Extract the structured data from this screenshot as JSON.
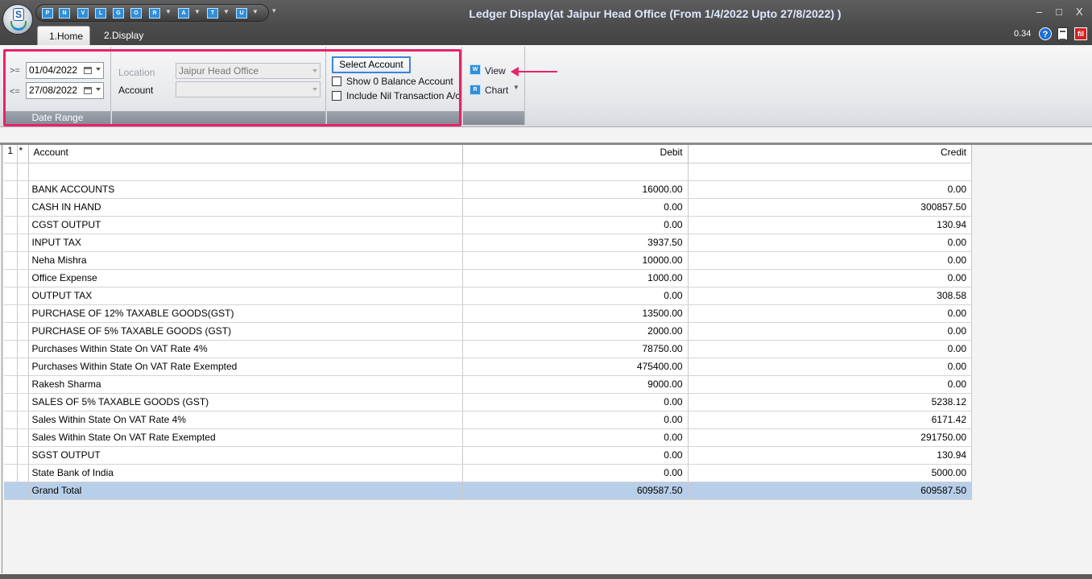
{
  "window": {
    "title": "Ledger Display(at Jaipur Head Office  (From 1/4/2022 Upto 27/8/2022) )",
    "controls": [
      "–",
      "□",
      "X"
    ]
  },
  "quick_access": [
    "P",
    "N",
    "V",
    "L",
    "G",
    "O",
    "R",
    "A",
    "T",
    "U"
  ],
  "tabs": [
    {
      "label": "1.Home",
      "active": true
    },
    {
      "label": "2.Display",
      "active": false
    }
  ],
  "status_right": {
    "value": "0.34"
  },
  "ribbon": {
    "date_range": {
      "from_op": ">=",
      "from_value": "01/04/2022",
      "to_op": "<=",
      "to_value": "27/08/2022",
      "group_label": "Date Range"
    },
    "location_label": "Location",
    "location_value": "Jaipur Head Office",
    "account_label": "Account",
    "account_value": "",
    "select_account_label": "Select Account",
    "show_zero_balance_label": "Show 0 Balance Account",
    "include_nil_label": "Include Nil Transaction A/c",
    "view_label": "View",
    "chart_label": "Chart"
  },
  "grid": {
    "header": {
      "rownum": "1",
      "star": "*",
      "account": "Account",
      "debit": "Debit",
      "credit": "Credit"
    },
    "rows": [
      {
        "account": "BANK ACCOUNTS",
        "debit": "16000.00",
        "credit": "0.00"
      },
      {
        "account": "CASH IN HAND",
        "debit": "0.00",
        "credit": "300857.50"
      },
      {
        "account": "CGST OUTPUT",
        "debit": "0.00",
        "credit": "130.94"
      },
      {
        "account": "INPUT TAX",
        "debit": "3937.50",
        "credit": "0.00"
      },
      {
        "account": "Neha Mishra",
        "debit": "10000.00",
        "credit": "0.00"
      },
      {
        "account": "Office Expense",
        "debit": "1000.00",
        "credit": "0.00"
      },
      {
        "account": "OUTPUT TAX",
        "debit": "0.00",
        "credit": "308.58"
      },
      {
        "account": "PURCHASE OF 12% TAXABLE GOODS(GST)",
        "debit": "13500.00",
        "credit": "0.00"
      },
      {
        "account": "PURCHASE OF 5% TAXABLE GOODS (GST)",
        "debit": "2000.00",
        "credit": "0.00"
      },
      {
        "account": "Purchases Within State On VAT Rate 4%",
        "debit": "78750.00",
        "credit": "0.00"
      },
      {
        "account": "Purchases Within State On VAT Rate Exempted",
        "debit": "475400.00",
        "credit": "0.00"
      },
      {
        "account": "Rakesh Sharma",
        "debit": "9000.00",
        "credit": "0.00"
      },
      {
        "account": "SALES OF 5% TAXABLE GOODS (GST)",
        "debit": "0.00",
        "credit": "5238.12"
      },
      {
        "account": "Sales Within State On VAT Rate 4%",
        "debit": "0.00",
        "credit": "6171.42"
      },
      {
        "account": "Sales Within State On VAT Rate Exempted",
        "debit": "0.00",
        "credit": "291750.00"
      },
      {
        "account": "SGST OUTPUT",
        "debit": "0.00",
        "credit": "130.94"
      },
      {
        "account": "State Bank of India",
        "debit": "0.00",
        "credit": "5000.00"
      }
    ],
    "total": {
      "account": "Grand Total",
      "debit": "609587.50",
      "credit": "609587.50"
    }
  },
  "colors": {
    "highlight": "#e8226a",
    "total_row": "#b8cfe9",
    "accent": "#2f8fd8"
  }
}
